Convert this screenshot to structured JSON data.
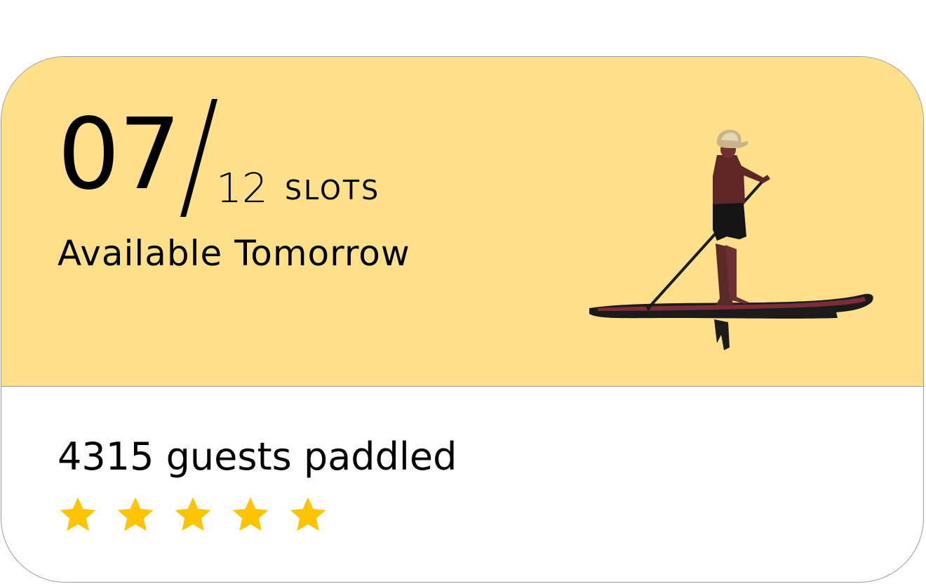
{
  "availability": {
    "available": "07",
    "total": "12",
    "unit": "SLOTS",
    "subtitle": "Available Tomorrow"
  },
  "guests": {
    "text": "4315 guests paddled"
  },
  "rating": {
    "value": 5,
    "max": 5,
    "star_color": "#ffc400"
  },
  "colors": {
    "top_background": "#ffe08a"
  },
  "icons": {
    "illustration": "paddleboarder-illustration",
    "star": "star-icon"
  }
}
